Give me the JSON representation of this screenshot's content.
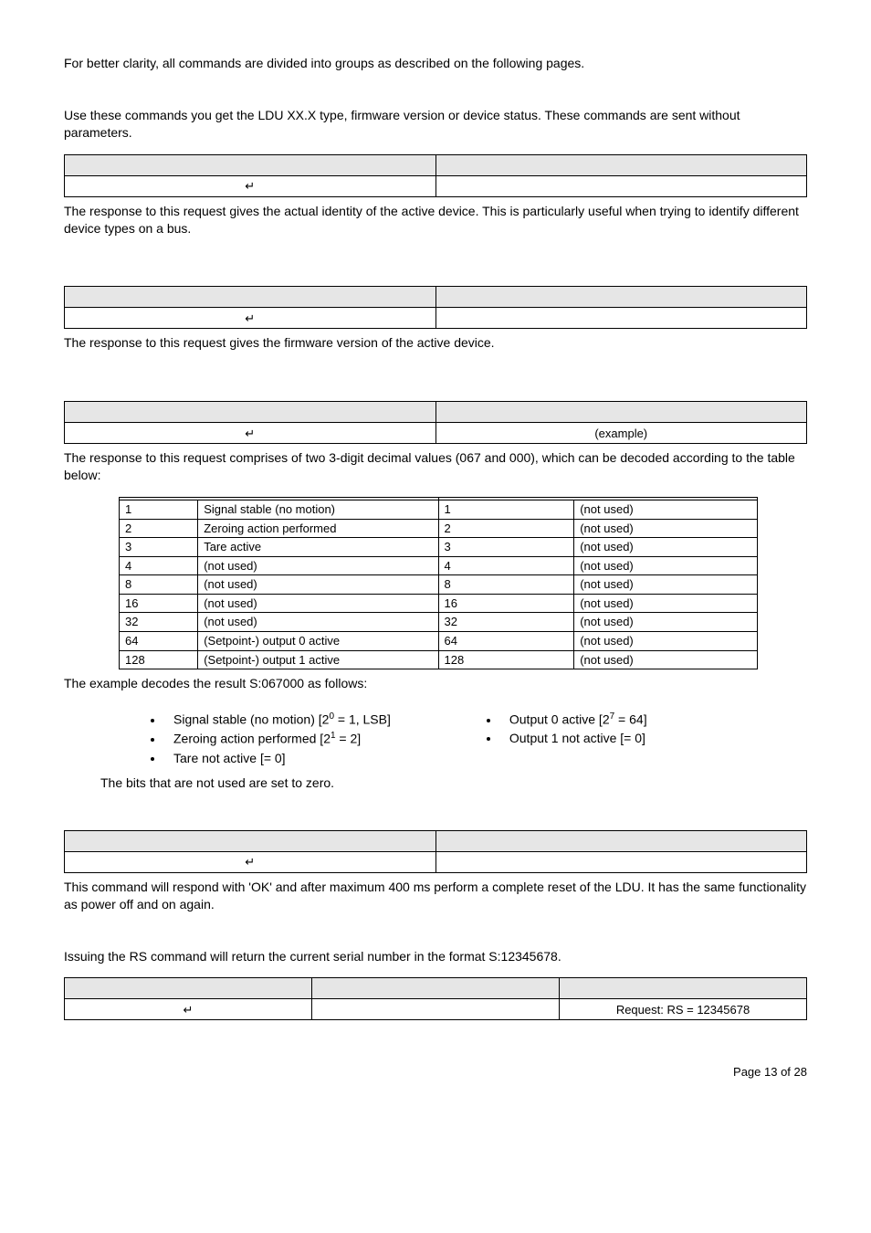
{
  "intro1": "For better clarity, all commands are divided into groups as described on the following pages.",
  "intro2": "Use these commands you get the LDU XX.X type, firmware version or device status. These commands are sent without parameters.",
  "arrow": "↵",
  "resp_identity": "The response to this request gives the actual identity of the active device. This is particularly useful when trying to identify different device types on a bus.",
  "resp_firmware": "The response to this request gives the firmware version of the active device.",
  "example_label": "(example)",
  "resp_status": "The response to this request comprises of two 3-digit decimal values (067 and 000), which can be decoded according to the table below:",
  "status_rows": [
    {
      "l_n": "1",
      "l_t": "Signal stable (no motion)",
      "r_n": "1",
      "r_t": "(not used)"
    },
    {
      "l_n": "2",
      "l_t": "Zeroing action performed",
      "r_n": "2",
      "r_t": "(not used)"
    },
    {
      "l_n": "3",
      "l_t": "Tare active",
      "r_n": "3",
      "r_t": "(not used)"
    },
    {
      "l_n": "4",
      "l_t": "(not used)",
      "r_n": "4",
      "r_t": "(not used)"
    },
    {
      "l_n": "8",
      "l_t": "(not used)",
      "r_n": "8",
      "r_t": "(not used)"
    },
    {
      "l_n": "16",
      "l_t": "(not used)",
      "r_n": "16",
      "r_t": "(not used)"
    },
    {
      "l_n": "32",
      "l_t": "(not used)",
      "r_n": "32",
      "r_t": "(not used)"
    },
    {
      "l_n": "64",
      "l_t": "(Setpoint-) output 0 active",
      "r_n": "64",
      "r_t": "(not used)"
    },
    {
      "l_n": "128",
      "l_t": "(Setpoint-) output 1 active",
      "r_n": "128",
      "r_t": "(not used)"
    }
  ],
  "decode_intro": "The example decodes the result S:067000 as follows:",
  "left_bullets": [
    "Signal stable (no motion) [2",
    "Zeroing action performed [2",
    "Tare not active [= 0]"
  ],
  "left_bullet_sup": [
    "0",
    " = 1, LSB]",
    "1",
    " = 2]"
  ],
  "right_bullets_prefix": [
    "Output 0 active [2",
    "Output 1 not active  [= 0]"
  ],
  "right_bullet_sup": [
    "7",
    " = 64]"
  ],
  "bits_note": "The bits that are not used are set to zero.",
  "reset_desc": "This command will respond with 'OK' and after maximum 400 ms perform a complete reset of the LDU.  It has the same functionality as power off and on again.",
  "rs_desc": "Issuing the RS command will return the current serial number in the format S:12345678.",
  "rs_example": "Request: RS = 12345678",
  "footer": "Page 13 of 28"
}
